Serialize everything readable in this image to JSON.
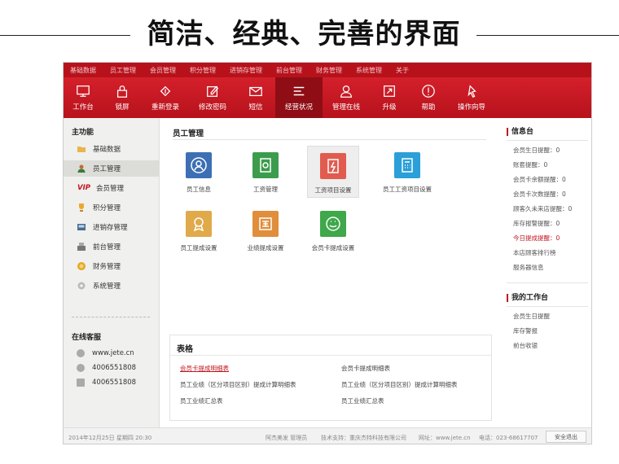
{
  "banner": {
    "title": "简洁、经典、完善的界面"
  },
  "topnav": [
    "基础数据",
    "员工管理",
    "会员管理",
    "积分管理",
    "进销存管理",
    "前台管理",
    "财务管理",
    "系统管理",
    "关于"
  ],
  "toolbar": [
    {
      "label": "工作台",
      "icon": "monitor-icon"
    },
    {
      "label": "锁屏",
      "icon": "lock-icon"
    },
    {
      "label": "重新登录",
      "icon": "refresh-login-icon"
    },
    {
      "label": "修改密码",
      "icon": "edit-icon"
    },
    {
      "label": "短信",
      "icon": "mail-icon"
    },
    {
      "label": "经营状况",
      "icon": "list-icon",
      "active": true
    },
    {
      "label": "管理在线",
      "icon": "user-icon"
    },
    {
      "label": "升级",
      "icon": "upgrade-icon"
    },
    {
      "label": "帮助",
      "icon": "help-icon"
    },
    {
      "label": "操作向导",
      "icon": "guide-icon"
    }
  ],
  "sidebar": {
    "heading": "主功能",
    "items": [
      {
        "label": "基础数据",
        "icon": "folder-icon"
      },
      {
        "label": "员工管理",
        "icon": "person-icon",
        "active": true
      },
      {
        "label": "会员管理",
        "icon": "vip-icon",
        "icon_text": "VIP"
      },
      {
        "label": "积分管理",
        "icon": "trophy-icon"
      },
      {
        "label": "进销存管理",
        "icon": "register-icon"
      },
      {
        "label": "前台管理",
        "icon": "desk-icon"
      },
      {
        "label": "财务管理",
        "icon": "coin-icon"
      },
      {
        "label": "系统管理",
        "icon": "gear-icon"
      }
    ],
    "service_heading": "在线客服",
    "contacts": [
      {
        "text": "www.jete.cn",
        "icon": "globe-icon"
      },
      {
        "text": "4006551808",
        "icon": "phone-icon"
      },
      {
        "text": "4006551808",
        "icon": "fax-icon"
      }
    ]
  },
  "main": {
    "section_title": "员工管理",
    "tiles": [
      {
        "label": "员工信息",
        "color": "#3d6fb5",
        "icon": "employee-icon"
      },
      {
        "label": "工资管理",
        "color": "#3c9c4d",
        "icon": "salary-icon"
      },
      {
        "label": "工资项目设置",
        "color": "#e25b4f",
        "icon": "salary-item-icon",
        "selected": true
      },
      {
        "label": "员工工资项目设置",
        "color": "#2a9fd8",
        "icon": "calculator-icon"
      },
      {
        "label": "员工提成设置",
        "color": "#e0a94a",
        "icon": "award-icon"
      },
      {
        "label": "业绩提成设置",
        "color": "#e08e3c",
        "icon": "performance-icon"
      },
      {
        "label": "会员卡提成设置",
        "color": "#3ea84a",
        "icon": "smile-icon"
      }
    ],
    "table_title": "表格",
    "reports": [
      "会员卡提成明细表",
      "会员卡提成明细表",
      "员工业绩（区分项目区别）提成计算明细表",
      "员工业绩（区分项目区别）提成计算明细表",
      "员工业绩汇总表",
      "员工业绩汇总表"
    ]
  },
  "right": {
    "info_heading": "信息台",
    "info": [
      {
        "text": "会员生日提醒：0"
      },
      {
        "text": "账套提醒：0"
      },
      {
        "text": "会员卡余额提醒：0"
      },
      {
        "text": "会员卡次数提醒：0"
      },
      {
        "text": "顾客久未来店提醒：0"
      },
      {
        "text": "库存报警提醒：0"
      },
      {
        "text": "今日提成提醒：0",
        "red": true
      },
      {
        "text": "本店顾客排行榜"
      },
      {
        "text": "服务器信息"
      }
    ],
    "work_heading": "我的工作台",
    "work": [
      "会员生日提醒",
      "库存警报",
      "前台收银"
    ]
  },
  "footer": {
    "datetime": "2014年12月25日  星期四 20:30",
    "user": "阿杰美发  管理员",
    "support": "技术支持：重庆杰特科技有限公司",
    "website": "网址：www.jete.cn",
    "phone": "电话：023-68617707",
    "exit": "安全退出"
  }
}
